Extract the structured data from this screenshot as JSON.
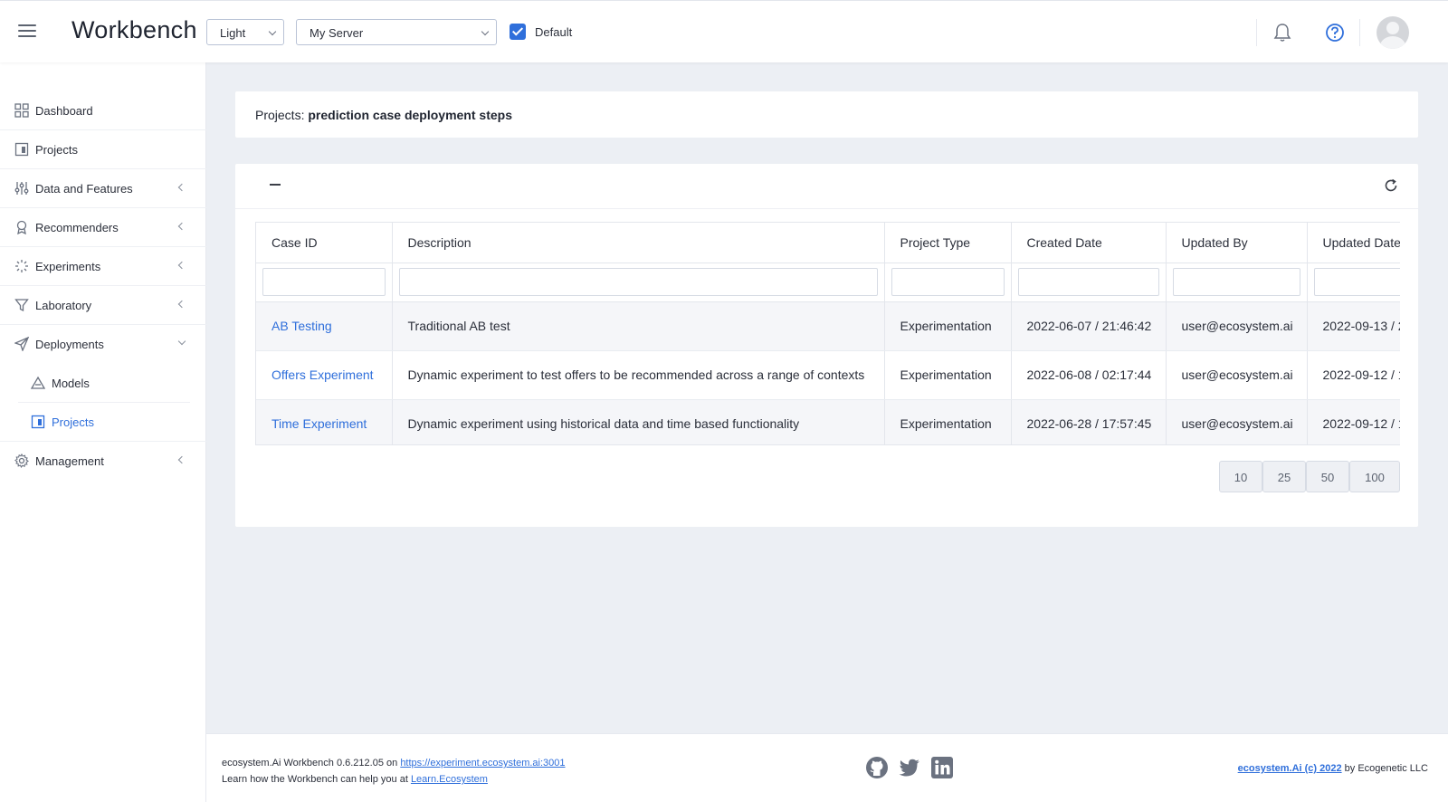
{
  "header": {
    "brand": "Workbench",
    "theme_select": "Light",
    "server_select": "My Server",
    "default_label": "Default"
  },
  "sidebar": {
    "items": [
      {
        "label": "Dashboard"
      },
      {
        "label": "Projects"
      },
      {
        "label": "Data and Features"
      },
      {
        "label": "Recommenders"
      },
      {
        "label": "Experiments"
      },
      {
        "label": "Laboratory"
      },
      {
        "label": "Deployments"
      },
      {
        "label": "Models"
      },
      {
        "label": "Projects"
      },
      {
        "label": "Management"
      }
    ]
  },
  "main": {
    "title_prefix": "Projects:",
    "title_value": "prediction case deployment steps",
    "table": {
      "columns": [
        "Case ID",
        "Description",
        "Project Type",
        "Created Date",
        "Updated By",
        "Updated Date"
      ],
      "rows": [
        [
          "AB Testing",
          "Traditional AB test",
          "Experimentation",
          "2022-06-07 / 21:46:42",
          "user@ecosystem.ai",
          "2022-09-13 / 2"
        ],
        [
          "Offers Experiment",
          "Dynamic experiment to test offers to be recommended across a range of contexts",
          "Experimentation",
          "2022-06-08 / 02:17:44",
          "user@ecosystem.ai",
          "2022-09-12 / 1"
        ],
        [
          "Time Experiment",
          "Dynamic experiment using historical data and time based functionality",
          "Experimentation",
          "2022-06-28 / 17:57:45",
          "user@ecosystem.ai",
          "2022-09-12 / 1"
        ]
      ]
    },
    "page_sizes": [
      "10",
      "25",
      "50",
      "100"
    ]
  },
  "footer": {
    "version_text": "ecosystem.Ai Workbench 0.6.212.05 on",
    "server_url": "https://experiment.ecosystem.ai:3001",
    "learn_text": "Learn how the Workbench can help you at",
    "learn_link": "Learn.Ecosystem",
    "copyright_link": "ecosystem.Ai (c) 2022",
    "copyright_suffix": "by Ecogenetic LLC"
  },
  "colors": {
    "accent": "#2f6fdb",
    "background": "#eceff4"
  }
}
